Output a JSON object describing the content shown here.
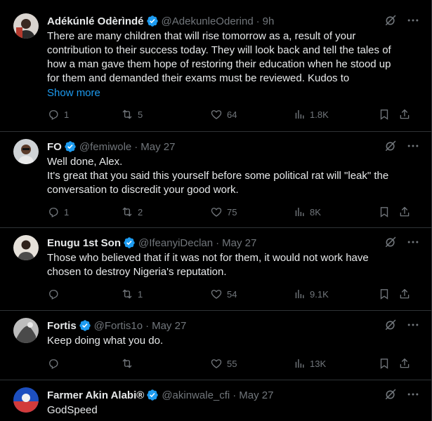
{
  "tweets": [
    {
      "name": "Adékúnlé Odèrìndé",
      "handle": "@AdekunleOderind",
      "time": "9h",
      "text_lines": [
        "There are many children that will rise tomorrow as a, result of your",
        "contribution to their success today. They will look back and tell the tales of",
        "how a man gave them hope of restoring their education when he stood up",
        "for them and demanded their exams must be reviewed. Kudos to"
      ],
      "show_more": "Show more",
      "replies": "1",
      "retweets": "5",
      "likes": "64",
      "views": "1.8K"
    },
    {
      "name": "FO",
      "handle": "@femiwole",
      "time": "May 27",
      "text_lines": [
        "Well done, Alex.",
        "It's great that you said this yourself before some political rat will \"leak\" the",
        "conversation to discredit your good work."
      ],
      "replies": "1",
      "retweets": "2",
      "likes": "75",
      "views": "8K"
    },
    {
      "name": "Enugu 1st Son",
      "handle": "@IfeanyiDeclan",
      "time": "May 27",
      "text_lines": [
        "Those who believed that if it was not for them, it would not work have",
        "chosen to destroy Nigeria's reputation."
      ],
      "replies": "",
      "retweets": "1",
      "likes": "54",
      "views": "9.1K"
    },
    {
      "name": "Fortis",
      "handle": "@Fortis1o",
      "time": "May 27",
      "text_lines": [
        "Keep doing what you do."
      ],
      "replies": "",
      "retweets": "",
      "likes": "55",
      "views": "13K"
    },
    {
      "name": "Farmer Akin Alabi®",
      "handle": "@akinwale_cfi",
      "time": "May 27",
      "text_lines": [
        "GodSpeed"
      ]
    }
  ],
  "colors": {
    "background": "#000000",
    "text": "#e7e9ea",
    "muted": "#71767b",
    "accent": "#1d9bf0",
    "border": "#2f3336"
  }
}
